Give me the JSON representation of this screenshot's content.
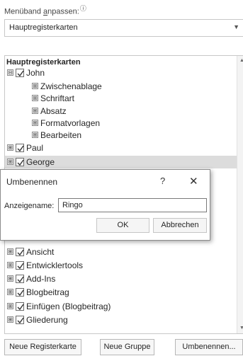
{
  "header": {
    "label_prefix": "Menüband ",
    "label_underlined": "a",
    "label_suffix": "npassen:",
    "info_glyph": "ⓘ",
    "dropdown_value": "Hauptregisterkarten"
  },
  "tree": {
    "header": "Hauptregisterkarten",
    "items": [
      {
        "text": "John",
        "expand": "⊟",
        "checked": true,
        "level": 0
      },
      {
        "text": "Zwischenablage",
        "expand": "⊞",
        "level": 1
      },
      {
        "text": "Schriftart",
        "expand": "⊞",
        "level": 1
      },
      {
        "text": "Absatz",
        "expand": "⊞",
        "level": 1
      },
      {
        "text": "Formatvorlagen",
        "expand": "⊞",
        "level": 1
      },
      {
        "text": "Bearbeiten",
        "expand": "⊞",
        "level": 1
      },
      {
        "text": "Paul",
        "expand": "⊞",
        "checked": true,
        "level": 0
      },
      {
        "text": "George",
        "expand": "⊞",
        "checked": true,
        "level": 0,
        "selected": true
      },
      {
        "text": "Ansicht",
        "expand": "⊞",
        "checked": true,
        "level": 0
      },
      {
        "text": "Entwicklertools",
        "expand": "⊞",
        "checked": true,
        "level": 0
      },
      {
        "text": "Add-Ins",
        "expand": "⊞",
        "checked": true,
        "level": 0
      },
      {
        "text": "Blogbeitrag",
        "expand": "⊞",
        "checked": true,
        "level": 0
      },
      {
        "text": "Einfügen (Blogbeitrag)",
        "expand": "⊞",
        "checked": true,
        "level": 0
      },
      {
        "text": "Gliederung",
        "expand": "⊞",
        "checked": true,
        "level": 0
      }
    ]
  },
  "dialog": {
    "title": "Umbenennen",
    "help": "?",
    "close": "✕",
    "field_label": "Anzeigename:",
    "field_value": "Ringo",
    "ok": "OK",
    "cancel": "Abbrechen"
  },
  "buttons": {
    "new_tab": "Neue Registerkarte",
    "new_group": "Neue Gruppe",
    "rename": "Umbenennen..."
  }
}
